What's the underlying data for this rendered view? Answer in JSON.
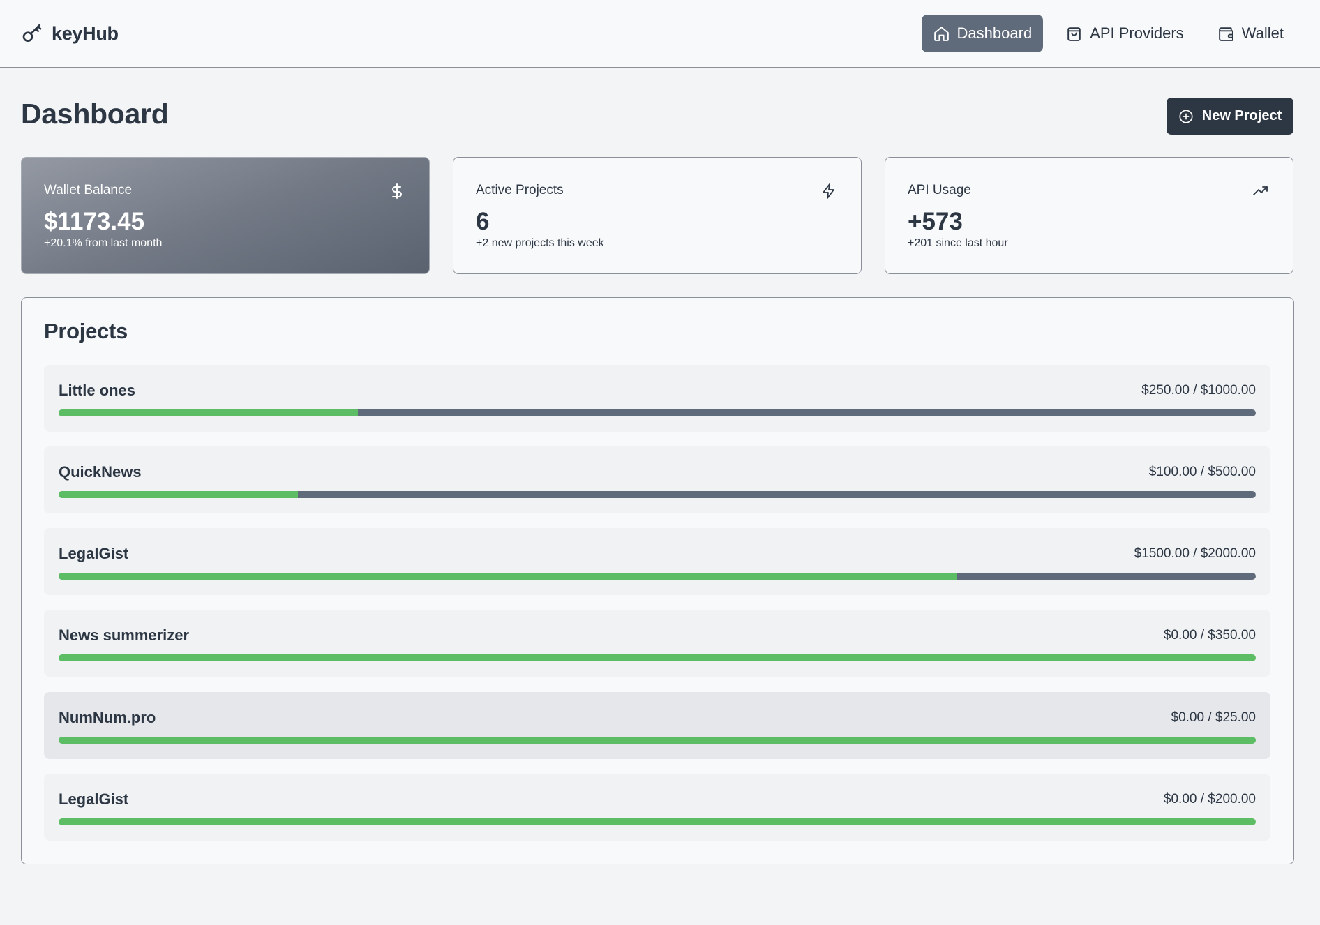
{
  "app": {
    "name": "keyHub"
  },
  "nav": {
    "items": [
      {
        "label": "Dashboard",
        "icon": "home-icon",
        "active": true
      },
      {
        "label": "API Providers",
        "icon": "shopping-bag-icon",
        "active": false
      },
      {
        "label": "Wallet",
        "icon": "wallet-icon",
        "active": false
      }
    ]
  },
  "page": {
    "title": "Dashboard",
    "new_project_label": "New Project"
  },
  "stats": {
    "wallet": {
      "label": "Wallet Balance",
      "value": "$1173.45",
      "sub": "+20.1% from last month",
      "icon": "dollar-icon"
    },
    "active_projects": {
      "label": "Active Projects",
      "value": "6",
      "sub": "+2 new projects this week",
      "icon": "lightning-icon"
    },
    "api_usage": {
      "label": "API Usage",
      "value": "+573",
      "sub": "+201 since last hour",
      "icon": "trending-up-icon"
    }
  },
  "projects": {
    "title": "Projects",
    "items": [
      {
        "name": "Little ones",
        "budget": "$250.00 / $1000.00",
        "progress": 0.25
      },
      {
        "name": "QuickNews",
        "budget": "$100.00 / $500.00",
        "progress": 0.2
      },
      {
        "name": "LegalGist",
        "budget": "$1500.00 / $2000.00",
        "progress": 0.75
      },
      {
        "name": "News summerizer",
        "budget": "$0.00 / $350.00",
        "progress": 1.0
      },
      {
        "name": "NumNum.pro",
        "budget": "$0.00 / $25.00",
        "progress": 1.0
      },
      {
        "name": "LegalGist",
        "budget": "$0.00 / $200.00",
        "progress": 1.0
      }
    ]
  },
  "colors": {
    "primary": "#2d3744",
    "nav_active": "#5f6a7a",
    "progress_fill": "#5cbd64",
    "progress_track": "#5f6a7a"
  }
}
